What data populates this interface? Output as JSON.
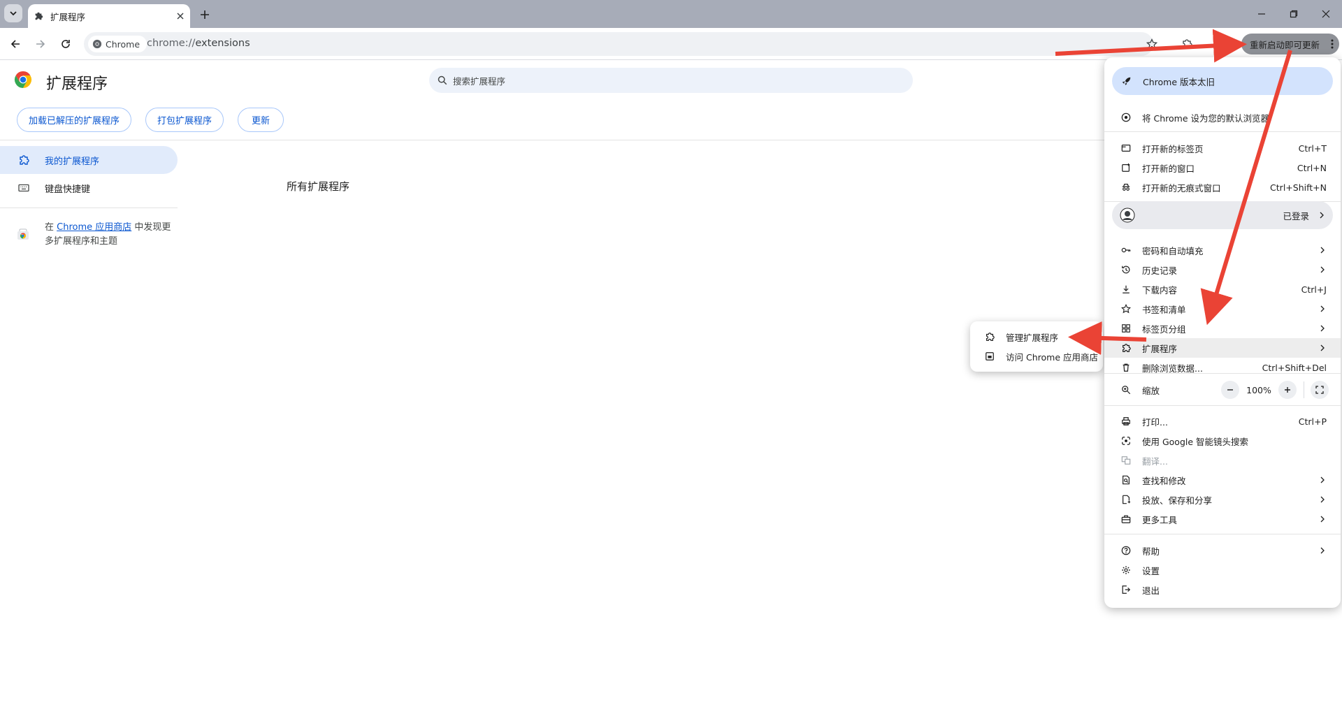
{
  "browser": {
    "tab_title": "扩展程序",
    "chip_label": "Chrome",
    "url_scheme": "chrome://",
    "url_path": "extensions",
    "update_button": "重新启动即可更新"
  },
  "page": {
    "title": "扩展程序",
    "search_placeholder": "搜索扩展程序",
    "buttons": {
      "load_unpacked": "加载已解压的扩展程序",
      "pack": "打包扩展程序",
      "update": "更新"
    },
    "sidebar": {
      "my_extensions": "我的扩展程序",
      "shortcuts": "键盘快捷键",
      "webstore_prefix": "在 ",
      "webstore_link": "Chrome 应用商店",
      "webstore_suffix": " 中发现更多扩展程序和主题"
    },
    "section_title": "所有扩展程序"
  },
  "menu": {
    "outdated": "Chrome 版本太旧",
    "set_default": "将 Chrome 设为您的默认浏览器",
    "new_tab": "打开新的标签页",
    "new_tab_sc": "Ctrl+T",
    "new_window": "打开新的窗口",
    "new_window_sc": "Ctrl+N",
    "incognito": "打开新的无痕式窗口",
    "incognito_sc": "Ctrl+Shift+N",
    "signed_in": "已登录",
    "passwords": "密码和自动填充",
    "history": "历史记录",
    "downloads": "下载内容",
    "downloads_sc": "Ctrl+J",
    "bookmarks": "书签和清单",
    "tab_groups": "标签页分组",
    "extensions": "扩展程序",
    "clear_data": "删除浏览数据...",
    "clear_data_sc": "Ctrl+Shift+Del",
    "zoom": "缩放",
    "zoom_level": "100%",
    "print": "打印...",
    "print_sc": "Ctrl+P",
    "lens": "使用 Google 智能镜头搜索",
    "translate": "翻译...",
    "find": "查找和修改",
    "cast": "投放、保存和分享",
    "more_tools": "更多工具",
    "help": "帮助",
    "settings": "设置",
    "exit": "退出"
  },
  "submenu": {
    "manage": "管理扩展程序",
    "webstore": "访问 Chrome 应用商店"
  },
  "colors": {
    "accent": "#0b57d0",
    "arrow": "#ea4335",
    "highlight": "#d3e3fd"
  }
}
